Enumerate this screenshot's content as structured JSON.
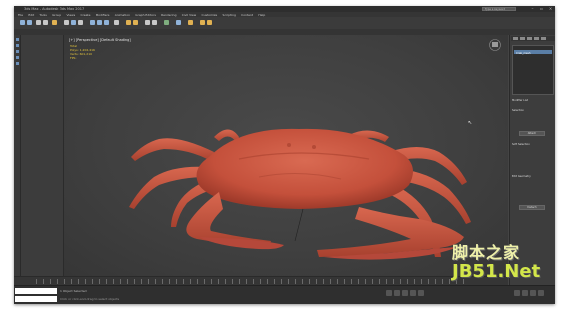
{
  "window": {
    "title": "3ds Max - Autodesk 3ds Max 2017",
    "search_placeholder": "Type a keyword"
  },
  "menu": [
    "File",
    "Edit",
    "Tools",
    "Group",
    "Views",
    "Create",
    "Modifiers",
    "Animation",
    "Graph Editors",
    "Rendering",
    "Civil View",
    "Customize",
    "Scripting",
    "Content",
    "Help"
  ],
  "viewport": {
    "label": "[+] [Perspective] [Default Shading]",
    "stats": [
      "Total",
      "Polys: 1,202,416",
      "Verts: 601,210",
      "",
      "FPS:"
    ]
  },
  "command_panel": {
    "list_selected": "Crab_mesh",
    "rollout_1": "Modifier List",
    "rollout_2": "Selection",
    "rollout_3": "Soft Selection",
    "rollout_4": "Edit Geometry",
    "button_1": "Attach",
    "button_2": "Detach"
  },
  "status": {
    "line1": "1 Object Selected",
    "line2": "Click or click-and-drag to select objects"
  },
  "watermark": {
    "chinese": "脚本之家",
    "site": "JB51.Net"
  },
  "colors": {
    "crab": "#c9543e",
    "background": "#444444"
  }
}
